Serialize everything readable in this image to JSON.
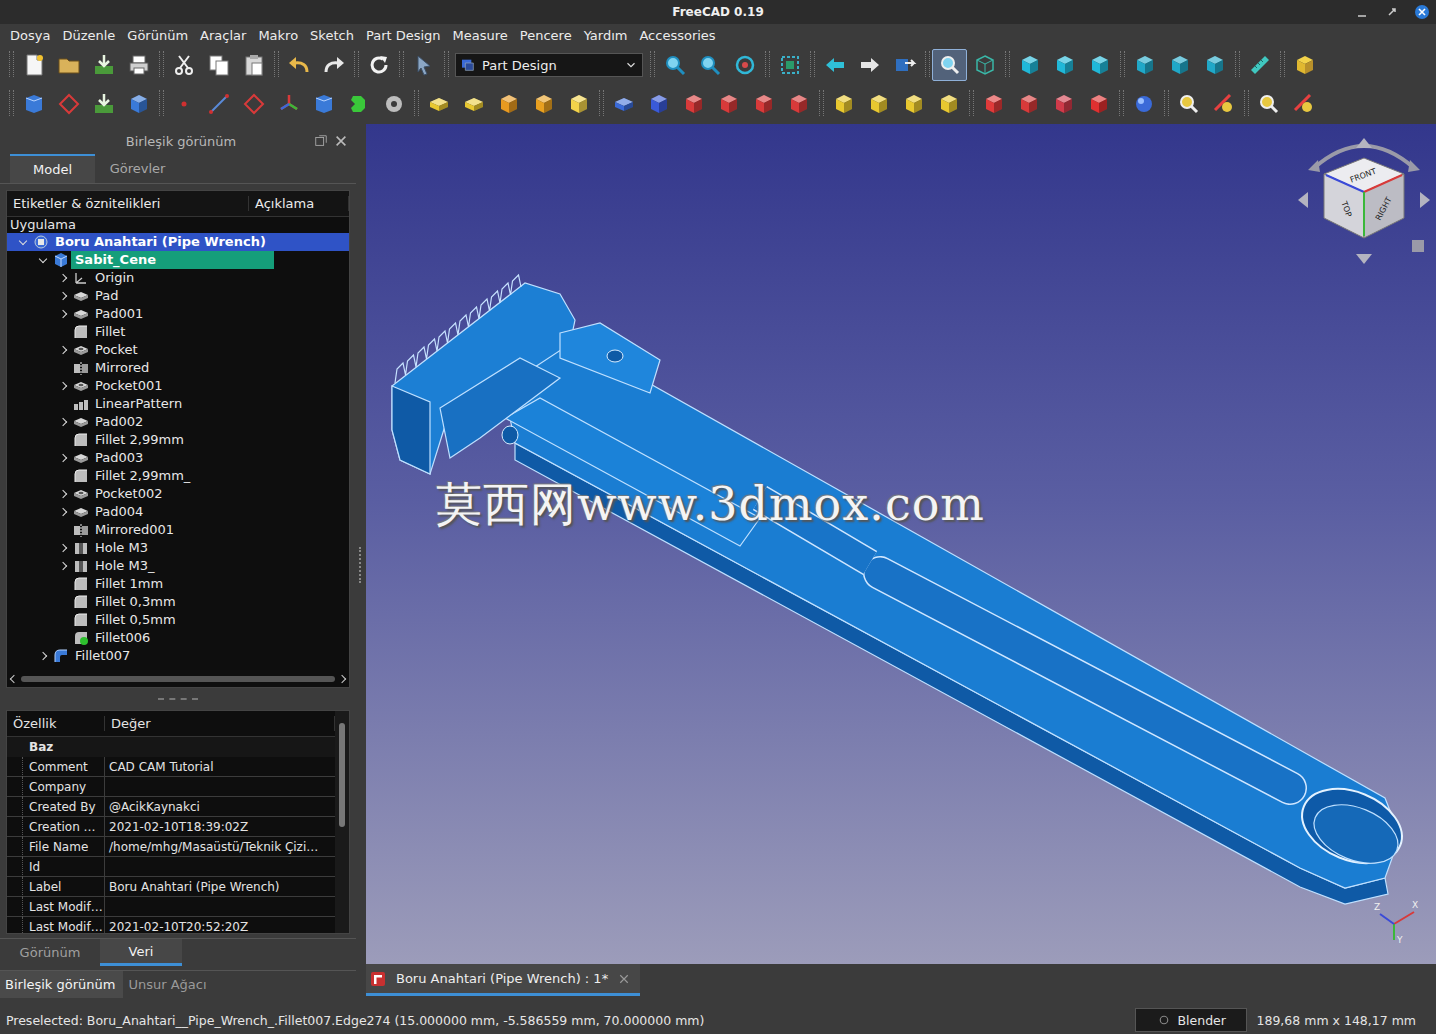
{
  "window": {
    "title": "FreeCAD 0.19"
  },
  "menu": [
    "Dosya",
    "Düzenle",
    "Görünüm",
    "Araçlar",
    "Makro",
    "Sketch",
    "Part Design",
    "Measure",
    "Pencere",
    "Yardım",
    "Accessories"
  ],
  "toolbar": {
    "workbench": "Part Design",
    "view_menu_pressed": true
  },
  "combo_view": {
    "title": "Birleşik görünüm",
    "tabs": [
      {
        "label": "Model",
        "selected": true
      },
      {
        "label": "Görevler",
        "selected": false
      }
    ],
    "tree": {
      "columns": [
        "Etiketler & öznitelikleri",
        "Açıklama"
      ],
      "section": "Uygulama",
      "items": [
        {
          "label": "Boru Anahtari (Pipe Wrench)",
          "depth": 0,
          "kind": "document",
          "expandable": true,
          "expanded": true,
          "selected": true,
          "active": false
        },
        {
          "label": "Sabit_Cene",
          "depth": 1,
          "kind": "body",
          "expandable": true,
          "expanded": true,
          "selected": false,
          "active": true
        },
        {
          "label": "Origin",
          "depth": 2,
          "kind": "origin",
          "expandable": true,
          "expanded": false,
          "selected": false,
          "active": false
        },
        {
          "label": "Pad",
          "depth": 2,
          "kind": "pad",
          "expandable": true,
          "expanded": false,
          "selected": false,
          "active": false
        },
        {
          "label": "Pad001",
          "depth": 2,
          "kind": "pad",
          "expandable": true,
          "expanded": false,
          "selected": false,
          "active": false
        },
        {
          "label": "Fillet",
          "depth": 2,
          "kind": "fillet",
          "expandable": false,
          "expanded": false,
          "selected": false,
          "active": false
        },
        {
          "label": "Pocket",
          "depth": 2,
          "kind": "pocket",
          "expandable": true,
          "expanded": false,
          "selected": false,
          "active": false
        },
        {
          "label": "Mirrored",
          "depth": 2,
          "kind": "mirrored",
          "expandable": false,
          "expanded": false,
          "selected": false,
          "active": false
        },
        {
          "label": "Pocket001",
          "depth": 2,
          "kind": "pocket",
          "expandable": true,
          "expanded": false,
          "selected": false,
          "active": false
        },
        {
          "label": "LinearPattern",
          "depth": 2,
          "kind": "pattern",
          "expandable": false,
          "expanded": false,
          "selected": false,
          "active": false
        },
        {
          "label": "Pad002",
          "depth": 2,
          "kind": "pad",
          "expandable": true,
          "expanded": false,
          "selected": false,
          "active": false
        },
        {
          "label": "Fillet 2,99mm",
          "depth": 2,
          "kind": "fillet",
          "expandable": false,
          "expanded": false,
          "selected": false,
          "active": false
        },
        {
          "label": "Pad003",
          "depth": 2,
          "kind": "pad",
          "expandable": true,
          "expanded": false,
          "selected": false,
          "active": false
        },
        {
          "label": "Fillet 2,99mm_",
          "depth": 2,
          "kind": "fillet",
          "expandable": false,
          "expanded": false,
          "selected": false,
          "active": false
        },
        {
          "label": "Pocket002",
          "depth": 2,
          "kind": "pocket",
          "expandable": true,
          "expanded": false,
          "selected": false,
          "active": false
        },
        {
          "label": "Pad004",
          "depth": 2,
          "kind": "pad",
          "expandable": true,
          "expanded": false,
          "selected": false,
          "active": false
        },
        {
          "label": "Mirrored001",
          "depth": 2,
          "kind": "mirrored",
          "expandable": false,
          "expanded": false,
          "selected": false,
          "active": false
        },
        {
          "label": "Hole M3",
          "depth": 2,
          "kind": "hole",
          "expandable": true,
          "expanded": false,
          "selected": false,
          "active": false
        },
        {
          "label": "Hole M3_",
          "depth": 2,
          "kind": "hole",
          "expandable": true,
          "expanded": false,
          "selected": false,
          "active": false
        },
        {
          "label": "Fillet 1mm",
          "depth": 2,
          "kind": "fillet",
          "expandable": false,
          "expanded": false,
          "selected": false,
          "active": false
        },
        {
          "label": "Fillet 0,3mm",
          "depth": 2,
          "kind": "fillet",
          "expandable": false,
          "expanded": false,
          "selected": false,
          "active": false
        },
        {
          "label": "Fillet 0,5mm",
          "depth": 2,
          "kind": "fillet",
          "expandable": false,
          "expanded": false,
          "selected": false,
          "active": false
        },
        {
          "label": "Fillet006",
          "depth": 2,
          "kind": "tip",
          "expandable": false,
          "expanded": false,
          "selected": false,
          "active": false
        },
        {
          "label": "Fillet007",
          "depth": 1,
          "kind": "part-fillet",
          "expandable": true,
          "expanded": false,
          "selected": false,
          "active": false
        }
      ]
    },
    "properties": {
      "columns": [
        "Özellik",
        "Değer"
      ],
      "group": "Baz",
      "rows": [
        {
          "name": "Comment",
          "value": "CAD CAM Tutorial"
        },
        {
          "name": "Company",
          "value": ""
        },
        {
          "name": "Created By",
          "value": "@AcikKaynakci"
        },
        {
          "name": "Creation …",
          "value": "2021-02-10T18:39:02Z"
        },
        {
          "name": "File Name",
          "value": "/home/mhg/Masaüstü/Teknik Çizi…"
        },
        {
          "name": "Id",
          "value": ""
        },
        {
          "name": "Label",
          "value": "Boru Anahtari (Pipe Wrench)"
        },
        {
          "name": "Last Modif…",
          "value": ""
        },
        {
          "name": "Last Modif…",
          "value": "2021-02-10T20:52:20Z"
        }
      ]
    },
    "view_tabs": [
      {
        "label": "Görünüm",
        "selected": false
      },
      {
        "label": "Veri",
        "selected": true
      }
    ]
  },
  "dock_tabs": [
    {
      "label": "Birleşik görünüm",
      "selected": true
    },
    {
      "label": "Unsur Ağacı",
      "selected": false
    }
  ],
  "viewport": {
    "watermark": "莫西网www.3dmox.com",
    "nav_cube": [
      "FRONT",
      "TOP",
      "RIGHT"
    ],
    "axes": [
      "X",
      "Y",
      "Z"
    ]
  },
  "document_tab": {
    "label": "Boru Anahtari (Pipe Wrench) : 1*",
    "selected": true
  },
  "status_bar": {
    "message": "Preselected: Boru_Anahtari__Pipe_Wrench_.Fillet007.Edge274 (15.000000 mm, -5.586559 mm, 70.000000 mm)",
    "renderer": "Blender",
    "dimensions": "189,68 mm x 148,17 mm"
  }
}
